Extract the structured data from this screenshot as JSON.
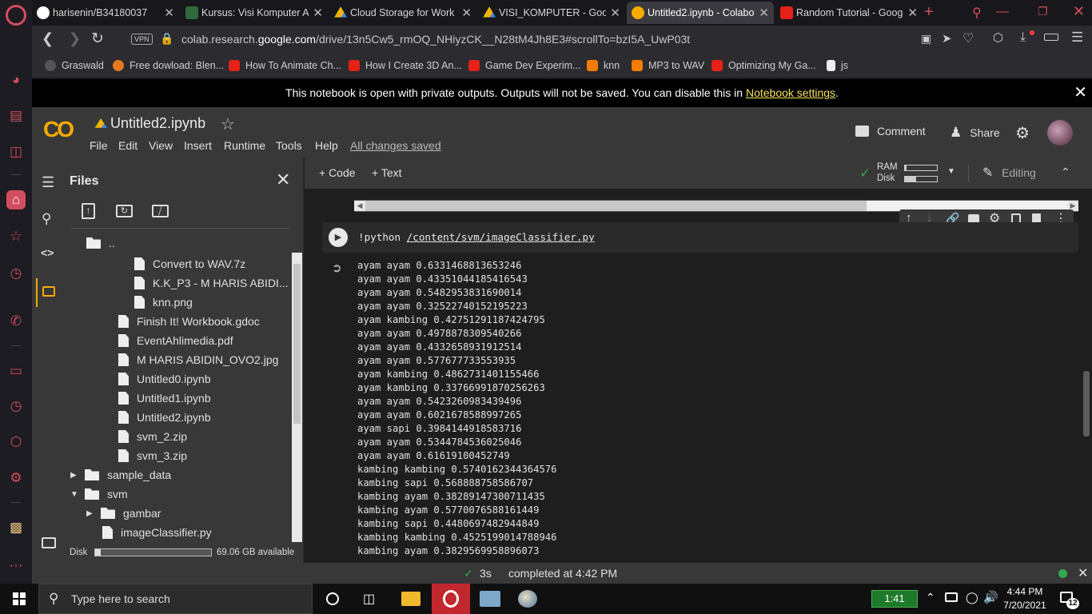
{
  "browser": {
    "tabs": [
      {
        "label": "harisenin/B34180037",
        "active": false
      },
      {
        "label": "Kursus: Visi Komputer A",
        "active": false
      },
      {
        "label": "Cloud Storage for Work a",
        "active": false
      },
      {
        "label": "VISI_KOMPUTER - Googl",
        "active": false
      },
      {
        "label": "Untitled2.ipynb - Colabo",
        "active": true
      },
      {
        "label": "Random Tutorial - Goog",
        "active": false
      }
    ],
    "vpn_label": "VPN",
    "url_prefix": "colab.research.",
    "url_domain": "google.com",
    "url_rest": "/drive/13n5Cw5_rmOQ_NHiyzCK__N28tM4Jh8E3#scrollTo=bzI5A_UwP03t",
    "bookmarks": [
      {
        "label": "Graswald",
        "color": "#555555"
      },
      {
        "label": "Free dowload: Blen...",
        "color": "#e37a1e"
      },
      {
        "label": "How To Animate Ch...",
        "color": "#e62117"
      },
      {
        "label": "How I Create 3D An...",
        "color": "#e62117"
      },
      {
        "label": "Game Dev Experim...",
        "color": "#e62117"
      },
      {
        "label": "knn",
        "color": "#f57c00"
      },
      {
        "label": "MP3 to WAV",
        "color": "#f57c00"
      },
      {
        "label": "Optimizing My Ga...",
        "color": "#e62117"
      },
      {
        "label": "js",
        "color": "#eeeeee"
      }
    ]
  },
  "notice": {
    "text": "This notebook is open with private outputs. Outputs will not be saved. You can disable this in ",
    "link": "Notebook settings",
    "end": "."
  },
  "colab": {
    "logo": "CO",
    "filename": "Untitled2.ipynb",
    "menu": [
      "File",
      "Edit",
      "View",
      "Insert",
      "Runtime",
      "Tools",
      "Help"
    ],
    "save_status": "All changes saved",
    "comment_label": "Comment",
    "share_label": "Share"
  },
  "files": {
    "title": "Files",
    "parent": "..",
    "items": [
      {
        "name": "Convert to WAV.7z",
        "type": "file",
        "level": 2
      },
      {
        "name": "K.K_P3 - M HARIS ABIDI...",
        "type": "file",
        "level": 2
      },
      {
        "name": "knn.png",
        "type": "file",
        "level": 2
      },
      {
        "name": "Finish It! Workbook.gdoc",
        "type": "file",
        "level": 1
      },
      {
        "name": "EventAhlimedia.pdf",
        "type": "file",
        "level": 1
      },
      {
        "name": "M HARIS ABIDIN_OVO2.jpg",
        "type": "file",
        "level": 1
      },
      {
        "name": "Untitled0.ipynb",
        "type": "file",
        "level": 1
      },
      {
        "name": "Untitled1.ipynb",
        "type": "file",
        "level": 1
      },
      {
        "name": "Untitled2.ipynb",
        "type": "file",
        "level": 1
      },
      {
        "name": "svm_2.zip",
        "type": "file",
        "level": 1
      },
      {
        "name": "svm_3.zip",
        "type": "file",
        "level": 1
      },
      {
        "name": "sample_data",
        "type": "folder",
        "level": 0,
        "expanded": false
      },
      {
        "name": "svm",
        "type": "folder",
        "level": 0,
        "expanded": true
      },
      {
        "name": "gambar",
        "type": "folder",
        "level": 1,
        "expanded": false
      },
      {
        "name": "imageClassifier.py",
        "type": "file",
        "level": 1
      }
    ],
    "disk_label": "Disk",
    "disk_available": "69.06 GB available",
    "disk_used_fraction": 0.05
  },
  "toolbar": {
    "code_label": "+ Code",
    "text_label": "+ Text",
    "ram_label": "RAM",
    "disk_label": "Disk",
    "ram_fraction": 0.05,
    "disk_fraction": 0.35,
    "editing_label": "Editing"
  },
  "cell": {
    "command_prefix": "!python ",
    "command_path": "/content/svm/imageClassifier.py",
    "output_lines": [
      "ayam ayam 0.6331468813653246",
      "ayam ayam 0.43351044185416543",
      "ayam ayam 0.5482953831690014",
      "ayam ayam 0.32522740152195223",
      "ayam kambing 0.42751291187424795",
      "ayam ayam 0.4978878309540266",
      "ayam ayam 0.4332658931912514",
      "ayam ayam 0.577677733553935",
      "ayam kambing 0.4862731401155466",
      "ayam kambing 0.33766991870256263",
      "ayam ayam 0.5423260983439496",
      "ayam ayam 0.6021678588997265",
      "ayam sapi 0.3984144918583716",
      "ayam ayam 0.5344784536025046",
      "ayam ayam 0.61619100452749",
      "kambing kambing 0.5740162344364576",
      "kambing sapi 0.568888758586707",
      "kambing ayam 0.38289147300711435",
      "kambing ayam 0.5770076588161449",
      "kambing sapi 0.4480697482944849",
      "kambing kambing 0.4525199014788946",
      "kambing ayam 0.3829569958896073"
    ]
  },
  "status": {
    "duration": "3s",
    "completed": "completed at 4:42 PM"
  },
  "taskbar": {
    "search_placeholder": "Type here to search",
    "battery_time": "1:41",
    "time": "4:44 PM",
    "date": "7/20/2021",
    "notifications": "12"
  },
  "colors": {
    "accent_orange": "#f9ab00",
    "opera_red": "#ff1b2d",
    "link_yellow": "#f6e15d",
    "success_green": "#34a853"
  }
}
